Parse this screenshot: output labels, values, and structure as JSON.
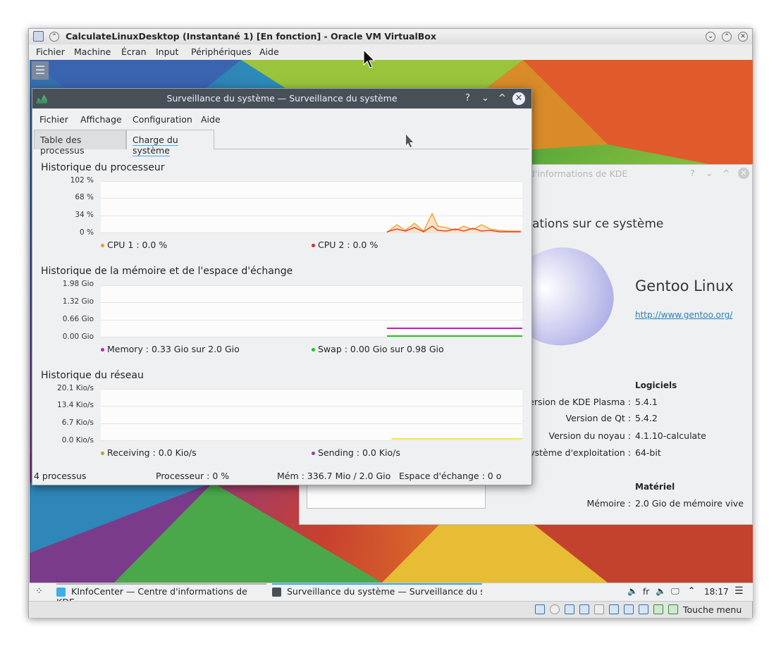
{
  "vbox": {
    "title": "CalculateLinuxDesktop (Instantané 1) [En fonction] - Oracle VM VirtualBox",
    "menu": [
      "Fichier",
      "Machine",
      "Écran",
      "Input",
      "Périphériques",
      "Aide"
    ],
    "status_label": "Touche menu"
  },
  "ksysguard": {
    "title": "Surveillance du système — Surveillance du système",
    "title_buttons": [
      "?",
      "⌄",
      "^",
      "✕"
    ],
    "menu": [
      "Fichier",
      "Affichage",
      "Configuration",
      "Aide"
    ],
    "tabs": [
      "Table des processus",
      "Charge du système"
    ],
    "cpu": {
      "title": "Historique du processeur",
      "yticks": [
        "102 %",
        "68 %",
        "34 %",
        "0 %"
      ],
      "legend": [
        {
          "label": "CPU 1 : 0.0 %",
          "color": "#f39c1f"
        },
        {
          "label": "CPU 2 : 0.0 %",
          "color": "#da2c2c"
        }
      ]
    },
    "mem": {
      "title": "Historique de la mémoire et de l'espace d'échange",
      "yticks": [
        "1.98 Gio",
        "1.32 Gio",
        "0.66 Gio",
        "0.00 Gio"
      ],
      "legend": [
        {
          "label": "Memory : 0.33 Gio sur 2.0 Gio",
          "color": "#c419c4"
        },
        {
          "label": "Swap : 0.00 Gio sur 0.98 Gio",
          "color": "#21c421"
        }
      ]
    },
    "net": {
      "title": "Historique du réseau",
      "yticks": [
        "20.1 Kio/s",
        "13.4 Kio/s",
        "6.7 Kio/s",
        "0.0 Kio/s"
      ],
      "legend": [
        {
          "label": "Receiving : 0.0 Kio/s",
          "color": "#b8a826"
        },
        {
          "label": "Sending : 0.0 Kio/s",
          "color": "#8e44ad"
        }
      ]
    },
    "statusbar": [
      "4 processus",
      "Processeur : 0 %",
      "Mém : 336.7 Mio / 2.0 Gio",
      "Espace d'échange : 0 o"
    ]
  },
  "kinfocenter": {
    "title": "d'informations de KDE",
    "heading": "ations sur ce système",
    "distro": "Gentoo Linux",
    "url": "http://www.gentoo.org/",
    "software_header": "Logiciels",
    "software": [
      {
        "label": "Version de KDE Plasma :",
        "value": "5.4.1"
      },
      {
        "label": "Version de Qt :",
        "value": "5.4.2"
      },
      {
        "label": "Version du noyau :",
        "value": "4.1.10-calculate"
      },
      {
        "label": "e système d'exploitation :",
        "value": "64-bit"
      }
    ],
    "hardware_header": "Matériel",
    "hardware": [
      {
        "label": "Mémoire :",
        "value": "2.0 Gio de mémoire vive"
      }
    ]
  },
  "taskbar": {
    "tasks": [
      "KInfoCenter — Centre d'informations de KDE",
      "Surveillance du système — Surveillance du sys"
    ],
    "lang": "fr",
    "clock": "18:17"
  }
}
